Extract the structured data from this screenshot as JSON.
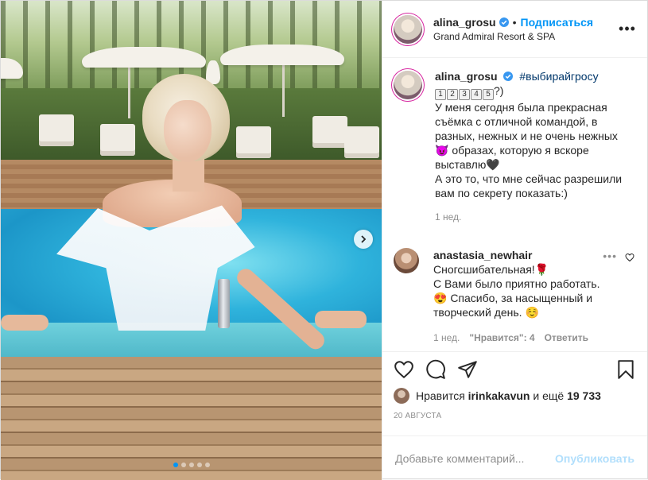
{
  "post": {
    "author": {
      "username": "alina_grosu",
      "verified": true,
      "follow_label": "Подписаться",
      "separator": "•",
      "location": "Grand Admiral Resort & SPA"
    },
    "caption": {
      "username": "alina_grosu",
      "hashtag": "#выбирайгросу",
      "keycaps": [
        "1",
        "2",
        "3",
        "4",
        "5"
      ],
      "keycap_suffix": "?)",
      "text": "У меня сегодня была прекрасная съёмка с отличной командой, в разных, нежных и не очень нежных 😈 образах, которую я вскоре выставлю🖤\nА это то, что мне сейчас разрешили вам по секрету показать:)",
      "time": "1 нед."
    },
    "comments": [
      {
        "username": "anastasia_newhair",
        "text": "Сногсшибательная!🌹\nС Вами было приятно работать.\n😍 Спасибо, за насыщенный и творческий день. ☺️",
        "time": "1 нед.",
        "likes_label": "\"Нравится\": 4",
        "reply_label": "Ответить"
      }
    ],
    "likes": {
      "prefix": "Нравится",
      "user": "irinkakavun",
      "suffix": "и ещё",
      "count": "19 733"
    },
    "date": "20 АВГУСТА",
    "add_comment": {
      "placeholder": "Добавьте комментарий...",
      "publish_label": "Опубликовать"
    },
    "carousel": {
      "total": 5,
      "current": 1
    }
  },
  "icons": {
    "like": "heart-icon",
    "comment": "comment-icon",
    "share": "share-icon",
    "save": "bookmark-icon",
    "more": "more-options-icon",
    "next": "chevron-right-icon"
  },
  "colors": {
    "accent": "#0095f6",
    "text": "#262626",
    "muted": "#8e8e8e",
    "publish_disabled": "#b2dffc"
  }
}
